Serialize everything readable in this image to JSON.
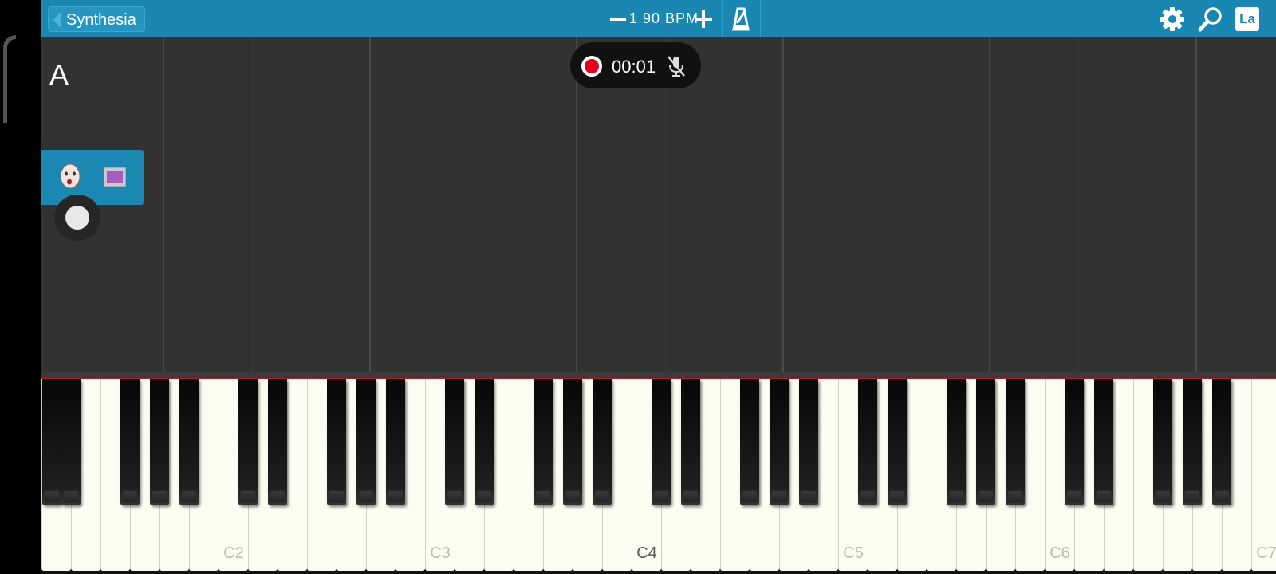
{
  "header": {
    "back_label": "Synthesia",
    "bpm_label": "1 90 BPM",
    "lang_label": "La"
  },
  "recorder": {
    "time": "00:01"
  },
  "notes_area": {
    "section_marker": "A"
  },
  "track": {
    "color": "#a95cc0"
  },
  "keyboard": {
    "octave_labels": [
      "C2",
      "C3",
      "C4",
      "C5",
      "C6",
      "C7"
    ]
  },
  "colors": {
    "toolbar": "#1987b2",
    "record": "#e0001b",
    "key_white": "#fcfcf1"
  }
}
